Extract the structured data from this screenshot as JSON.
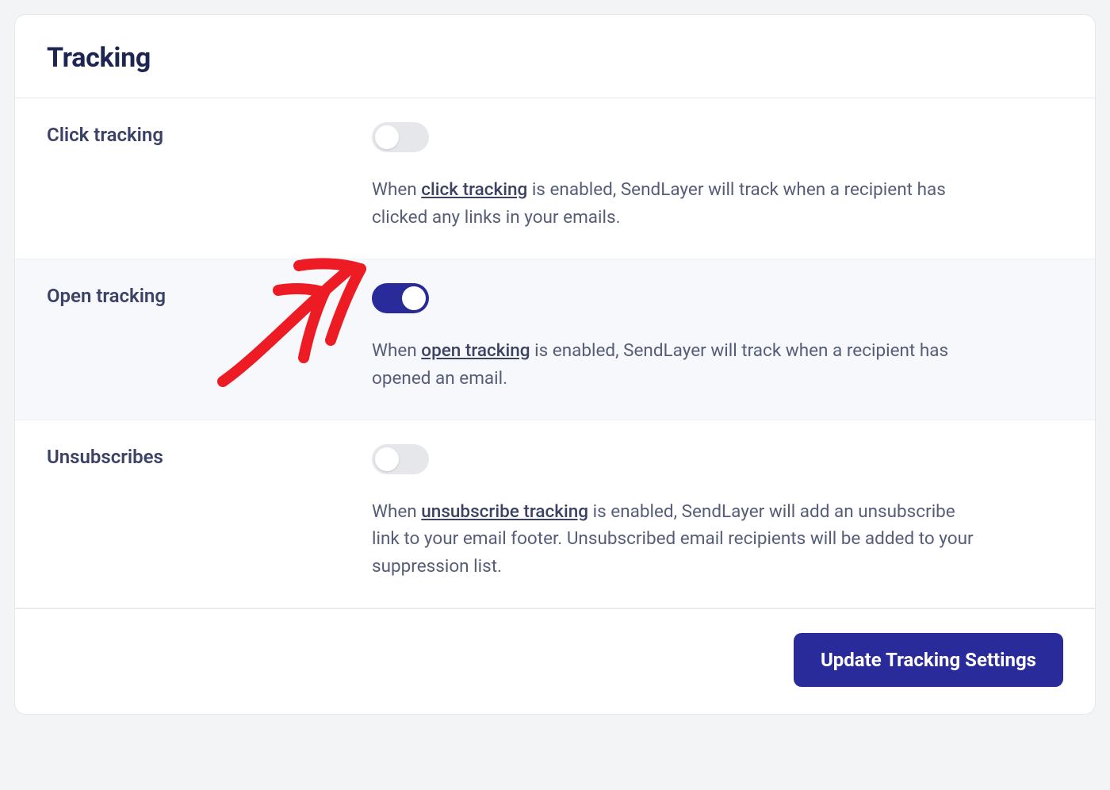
{
  "title": "Tracking",
  "rows": {
    "click": {
      "label": "Click tracking",
      "enabled": false,
      "desc_prefix": "When ",
      "desc_link": "click tracking",
      "desc_suffix": " is enabled, SendLayer will track when a recipient has clicked any links in your emails."
    },
    "open": {
      "label": "Open tracking",
      "enabled": true,
      "desc_prefix": "When ",
      "desc_link": "open tracking",
      "desc_suffix": " is enabled, SendLayer will track when a recipient has opened an email."
    },
    "unsub": {
      "label": "Unsubscribes",
      "enabled": false,
      "desc_prefix": "When ",
      "desc_link": "unsubscribe tracking",
      "desc_suffix": " is enabled, SendLayer will add an unsubscribe link to your email footer. Unsubscribed email recipients will be added to your suppression list."
    }
  },
  "button": "Update Tracking Settings",
  "colors": {
    "accent": "#2a2b9a",
    "annotation": "#ed1c24"
  }
}
